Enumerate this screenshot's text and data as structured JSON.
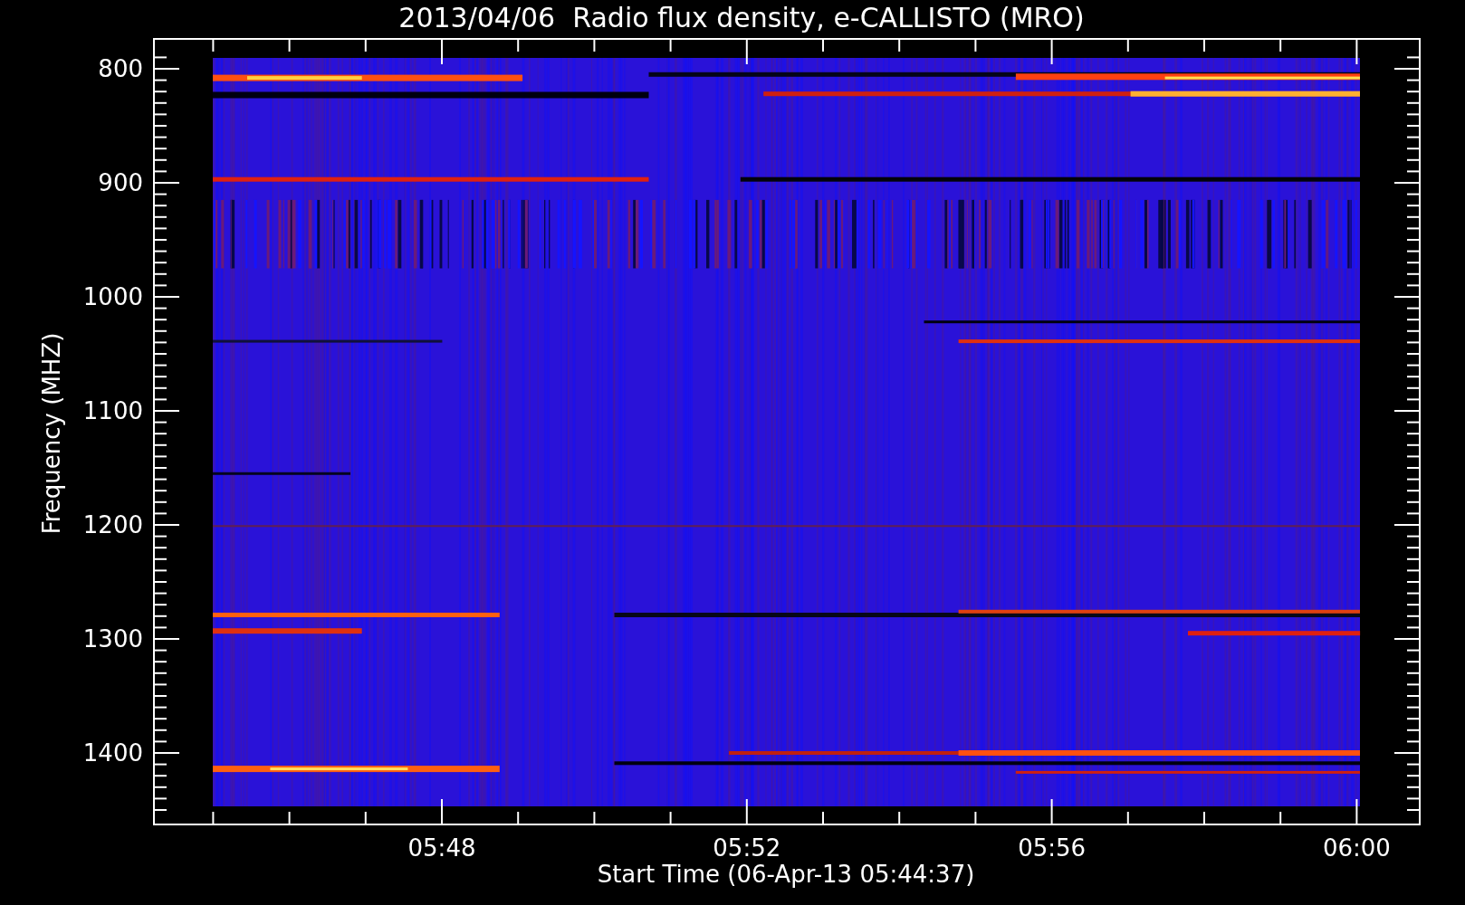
{
  "title": "2013/04/06  Radio flux density, e-CALLISTO (MRO)",
  "y_axis": {
    "label": "Frequency (MHZ)",
    "ticks": [
      "800",
      "900",
      "1000",
      "1100",
      "1200",
      "1300",
      "1400"
    ]
  },
  "x_axis": {
    "label": "Start Time (06-Apr-13 05:44:37)",
    "ticks": [
      "05:48",
      "05:52",
      "05:56",
      "06:00"
    ]
  }
}
